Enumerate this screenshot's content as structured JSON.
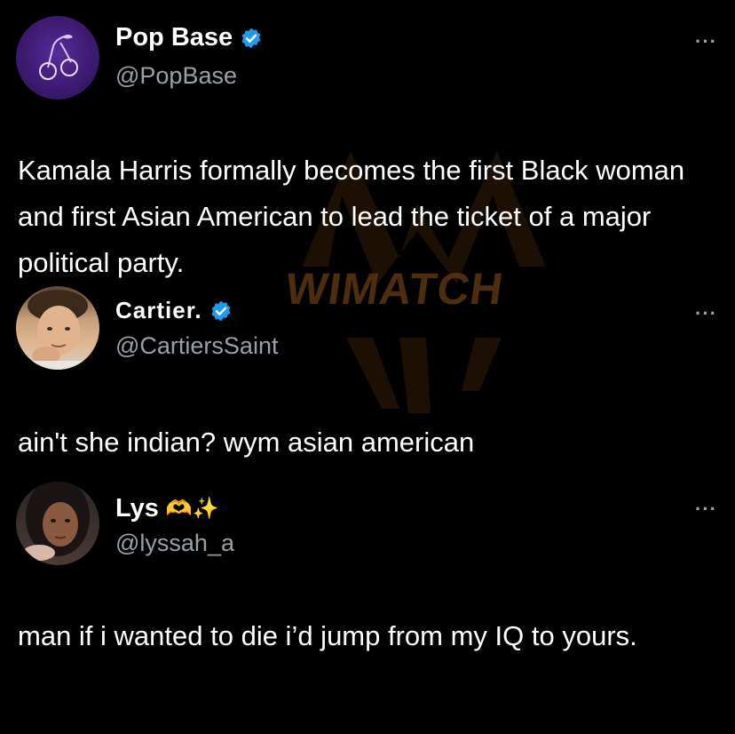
{
  "tweets": [
    {
      "display_name": "Pop Base",
      "handle": "@PopBase",
      "verified": true,
      "text": "Kamala Harris formally becomes the first Black woman and first Asian American to lead the ticket of a major political party.",
      "more_label": "···"
    },
    {
      "display_name": "Cartier.",
      "handle": "@CartiersSaint",
      "verified": true,
      "text": "ain't she indian? wym asian american",
      "more_label": "···"
    },
    {
      "display_name": "Lys",
      "name_emojis": "🫶✨",
      "handle": "@lyssah_a",
      "verified": false,
      "text": "man if i wanted to die i’d jump from my IQ to yours.",
      "more_label": "···"
    }
  ],
  "watermark": {
    "text": "WIMATCH"
  },
  "colors": {
    "background": "#000000",
    "name": "#ffffff",
    "handle": "#9aa0a6",
    "verified_badge": "#1d9bf0",
    "watermark": "#6b3d12"
  }
}
